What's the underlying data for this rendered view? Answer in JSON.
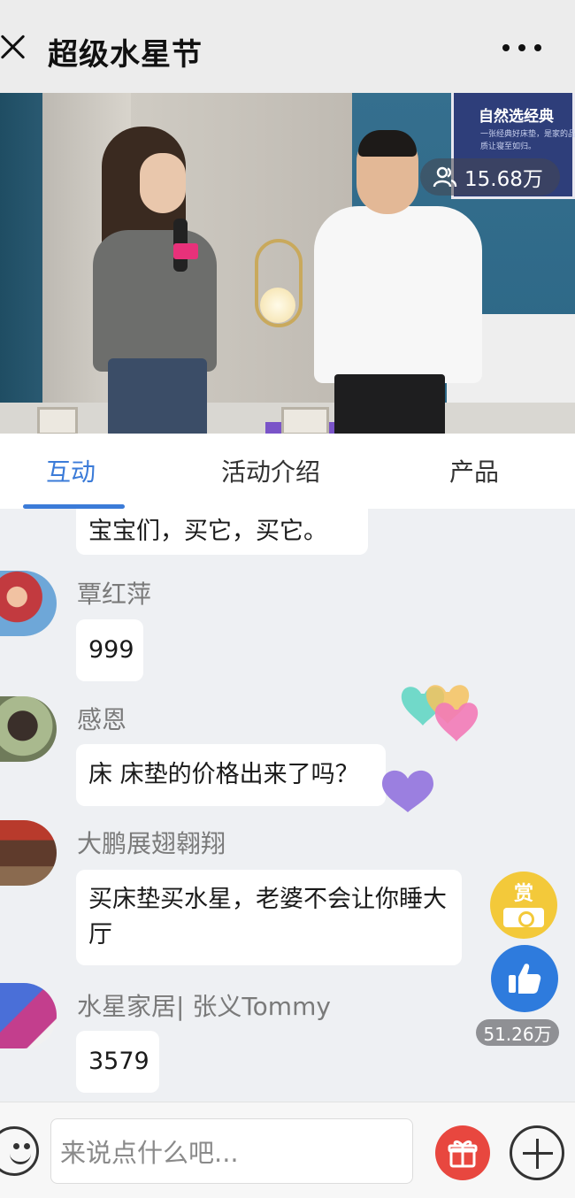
{
  "header": {
    "title": "超级水星节"
  },
  "video": {
    "viewer_count": "15.68万",
    "sign_line1": "自然选经典",
    "sign_line2": "一张经典好床垫，是家的品质让寝至如归。"
  },
  "tabs": [
    {
      "label": "互动",
      "active": true
    },
    {
      "label": "活动介绍",
      "active": false
    },
    {
      "label": "产品",
      "active": false
    }
  ],
  "chat": {
    "messages": [
      {
        "user": "",
        "text": "宝宝们，买它，买它。"
      },
      {
        "user": "覃红萍",
        "text": "999"
      },
      {
        "user": "感恩",
        "text": "床 床垫的价格出来了吗？"
      },
      {
        "user": "大鹏展翅翱翔",
        "text": "买床垫买水星，老婆不会让你睡大厅"
      },
      {
        "user": "水星家居| 张义Tommy",
        "text": "3579"
      }
    ]
  },
  "side_actions": {
    "reward_label": "赏",
    "like_count": "51.26万"
  },
  "input": {
    "placeholder": "来说点什么吧..."
  },
  "colors": {
    "accent": "#3b7bd8",
    "like": "#2e7bdd",
    "reward": "#f3c93a",
    "gift": "#e8473f"
  }
}
